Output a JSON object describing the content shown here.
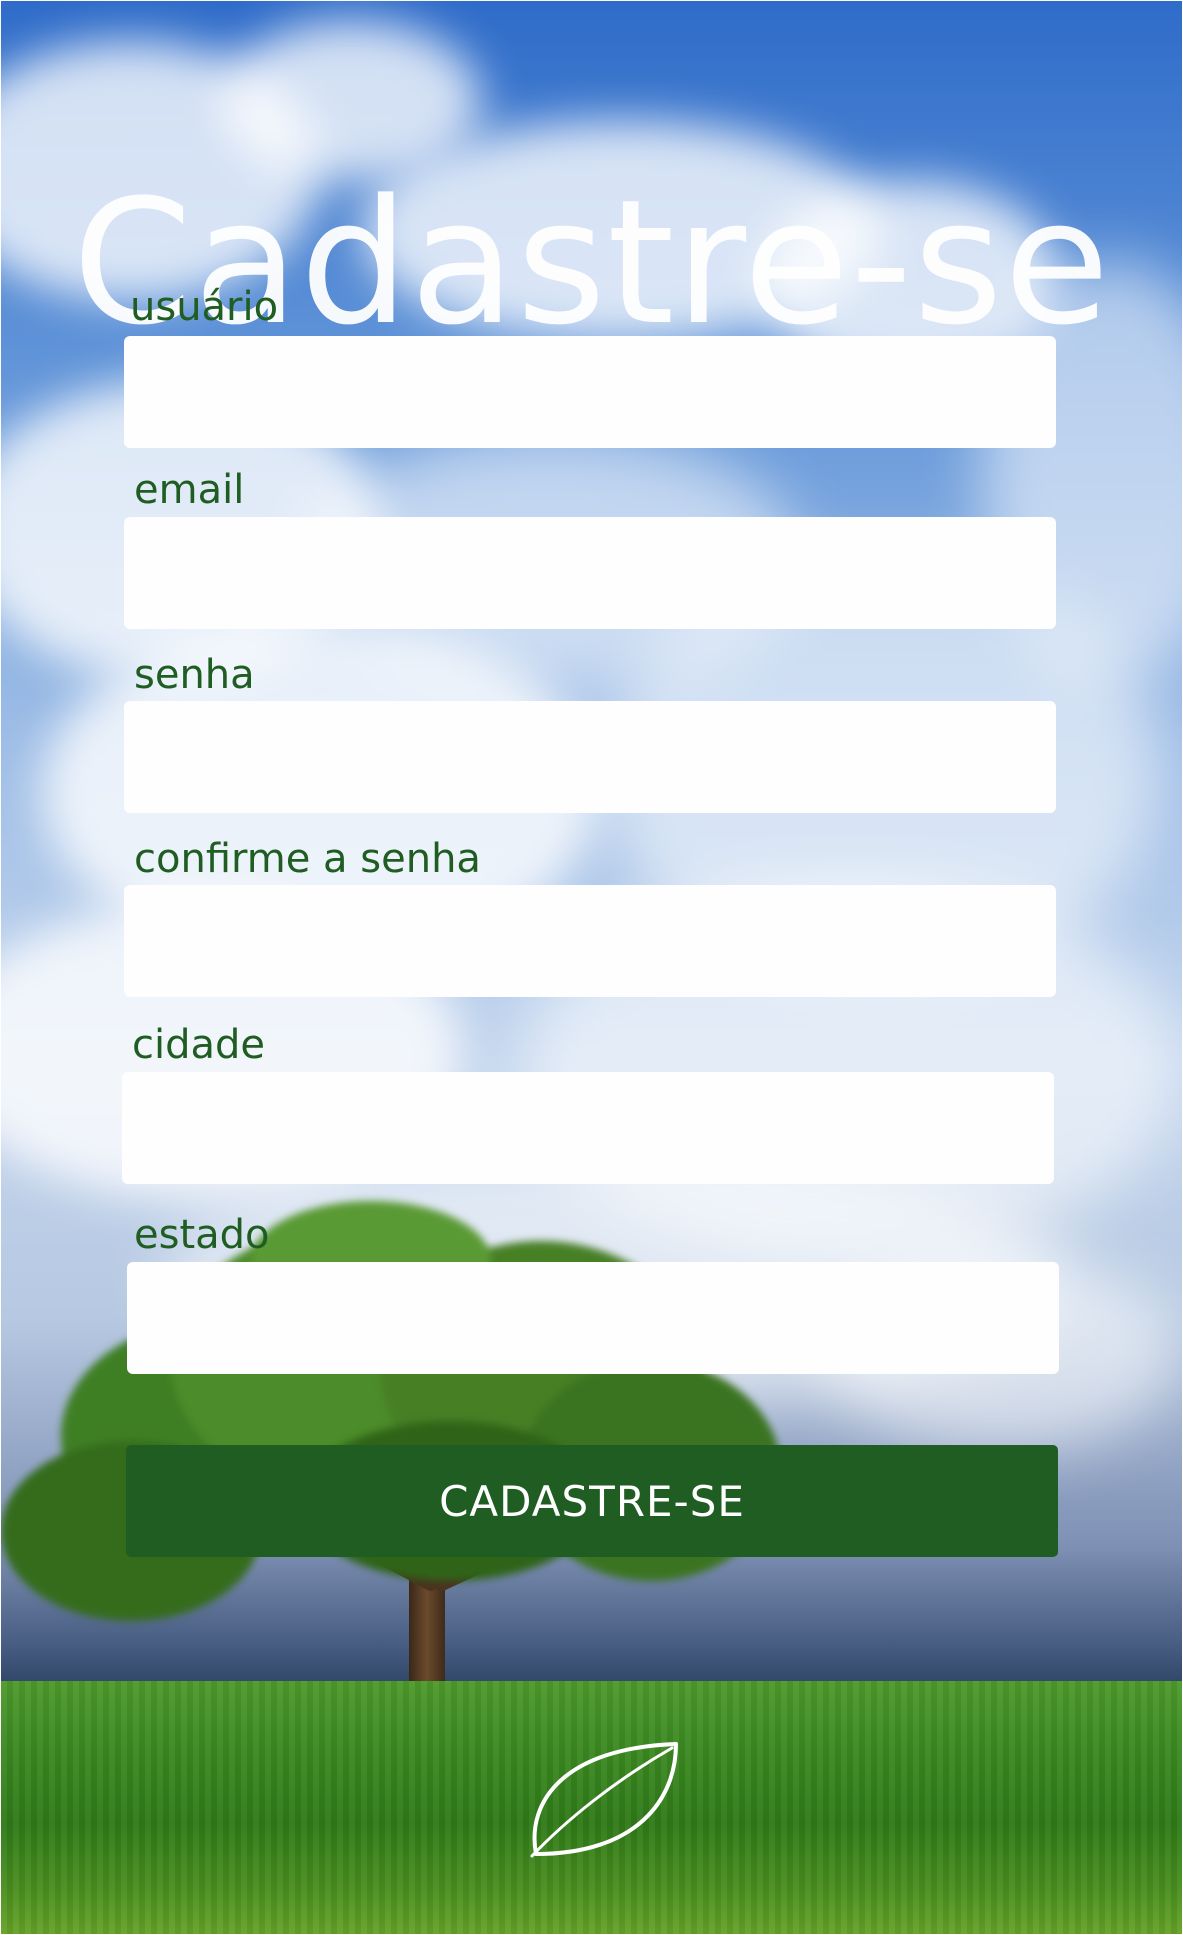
{
  "title": "Cadastre-se",
  "form": {
    "fields": [
      {
        "label": "usuário",
        "value": "",
        "type": "text"
      },
      {
        "label": "email",
        "value": "",
        "type": "email"
      },
      {
        "label": "senha",
        "value": "",
        "type": "password"
      },
      {
        "label": "confirme a senha",
        "value": "",
        "type": "password"
      },
      {
        "label": "cidade",
        "value": "",
        "type": "text"
      },
      {
        "label": "estado",
        "value": "",
        "type": "text"
      }
    ],
    "submit_label": "CADASTRE-SE"
  },
  "logo": {
    "icon": "leaf-icon"
  },
  "colors": {
    "accent": "#1f5d22",
    "label_text": "#1f5d22",
    "field_background": "#fefefe",
    "title_text": "#ffffff"
  }
}
